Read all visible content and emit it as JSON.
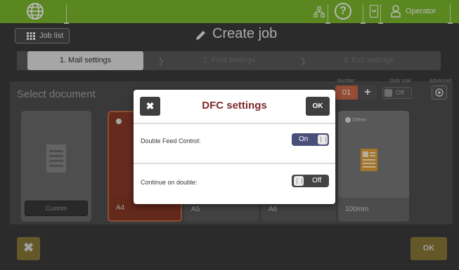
{
  "topbar": {
    "globe_icon": "globe-icon",
    "network_icon": "network-icon",
    "help_icon": "help-icon",
    "help_glyph": "?",
    "user_icon": "user-icon",
    "user_name": "Operator",
    "color": "#7dbb2c"
  },
  "header": {
    "job_list_label": "Job list",
    "title": "Create job"
  },
  "steps": {
    "items": [
      {
        "label": "1. Mail settings"
      },
      {
        "label": "2. Fold settings"
      },
      {
        "label": "3. Exit settings"
      }
    ]
  },
  "controls": {
    "number_label": "Number",
    "number_value": "01",
    "plus_glyph": "+",
    "daily_mail_label": "Daily mail",
    "daily_mail_value": "Off",
    "advanced_label": "Advanced"
  },
  "document": {
    "title": "Select document",
    "cards": [
      {
        "label": "Custom",
        "button": "Custom"
      },
      {
        "label": "A4"
      },
      {
        "label": "A5"
      },
      {
        "label": "A6"
      },
      {
        "label": "100mm",
        "tag": "100mm"
      }
    ]
  },
  "footer": {
    "cancel_glyph": "✖",
    "ok_label": "OK"
  },
  "modal": {
    "close_glyph": "✖",
    "title": "DFC settings",
    "ok_label": "OK",
    "rows": [
      {
        "label": "Double Feed Control:",
        "value": "On"
      },
      {
        "label": "Continue on double:",
        "value": "Off"
      }
    ],
    "title_color": "#7a2a2a"
  }
}
